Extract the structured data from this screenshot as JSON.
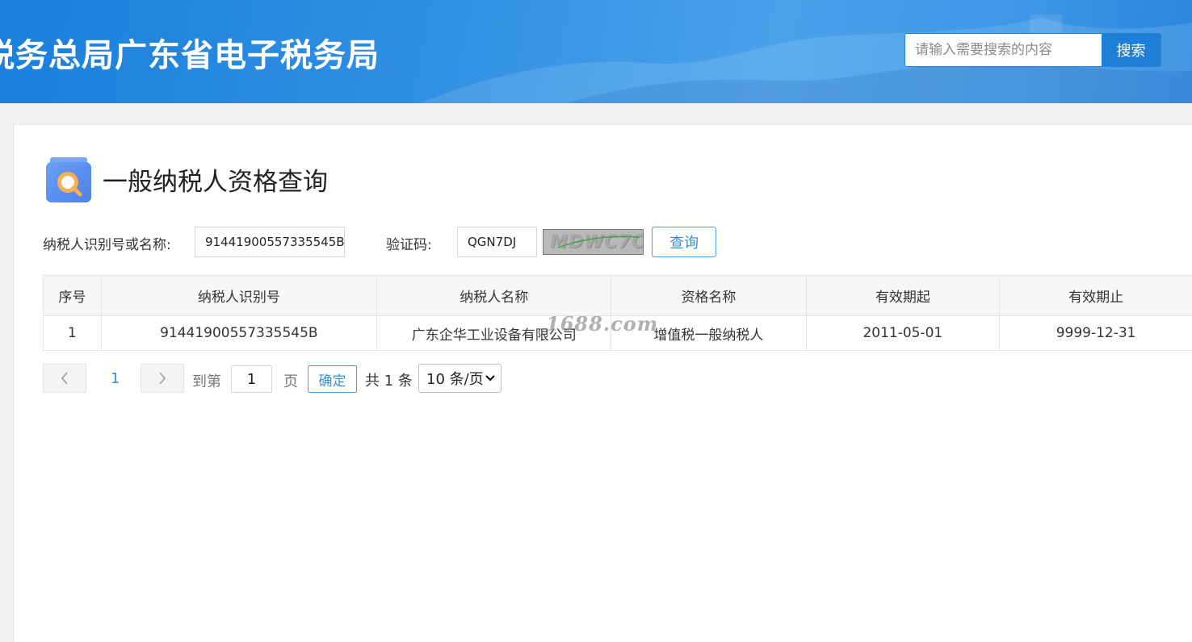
{
  "header": {
    "site_title": "税务总局广东省电子税务局",
    "search": {
      "placeholder": "请输入需要搜索的内容",
      "value": "",
      "button_label": "搜索"
    }
  },
  "page": {
    "title": "一般纳税人资格查询",
    "icon": "search-doc-icon"
  },
  "form": {
    "taxpayer_label": "纳税人识别号或名称:",
    "taxpayer_value": "91441900557335545B",
    "captcha_label": "验证码:",
    "captcha_value": "QGN7DJ",
    "captcha_image_text": "MDWC7C",
    "query_button": "查询"
  },
  "table": {
    "columns": [
      "序号",
      "纳税人识别号",
      "纳税人名称",
      "资格名称",
      "有效期起",
      "有效期止"
    ],
    "rows": [
      [
        "1",
        "91441900557335545B",
        "广东企华工业设备有限公司",
        "增值税一般纳税人",
        "2011-05-01",
        "9999-12-31"
      ]
    ],
    "watermark": "1688.com"
  },
  "pagination": {
    "current_page": "1",
    "goto_prefix": "到第",
    "goto_value": "1",
    "goto_suffix": "页",
    "confirm_label": "确定",
    "total_text": "共 1 条",
    "page_size": "10 条/页"
  }
}
